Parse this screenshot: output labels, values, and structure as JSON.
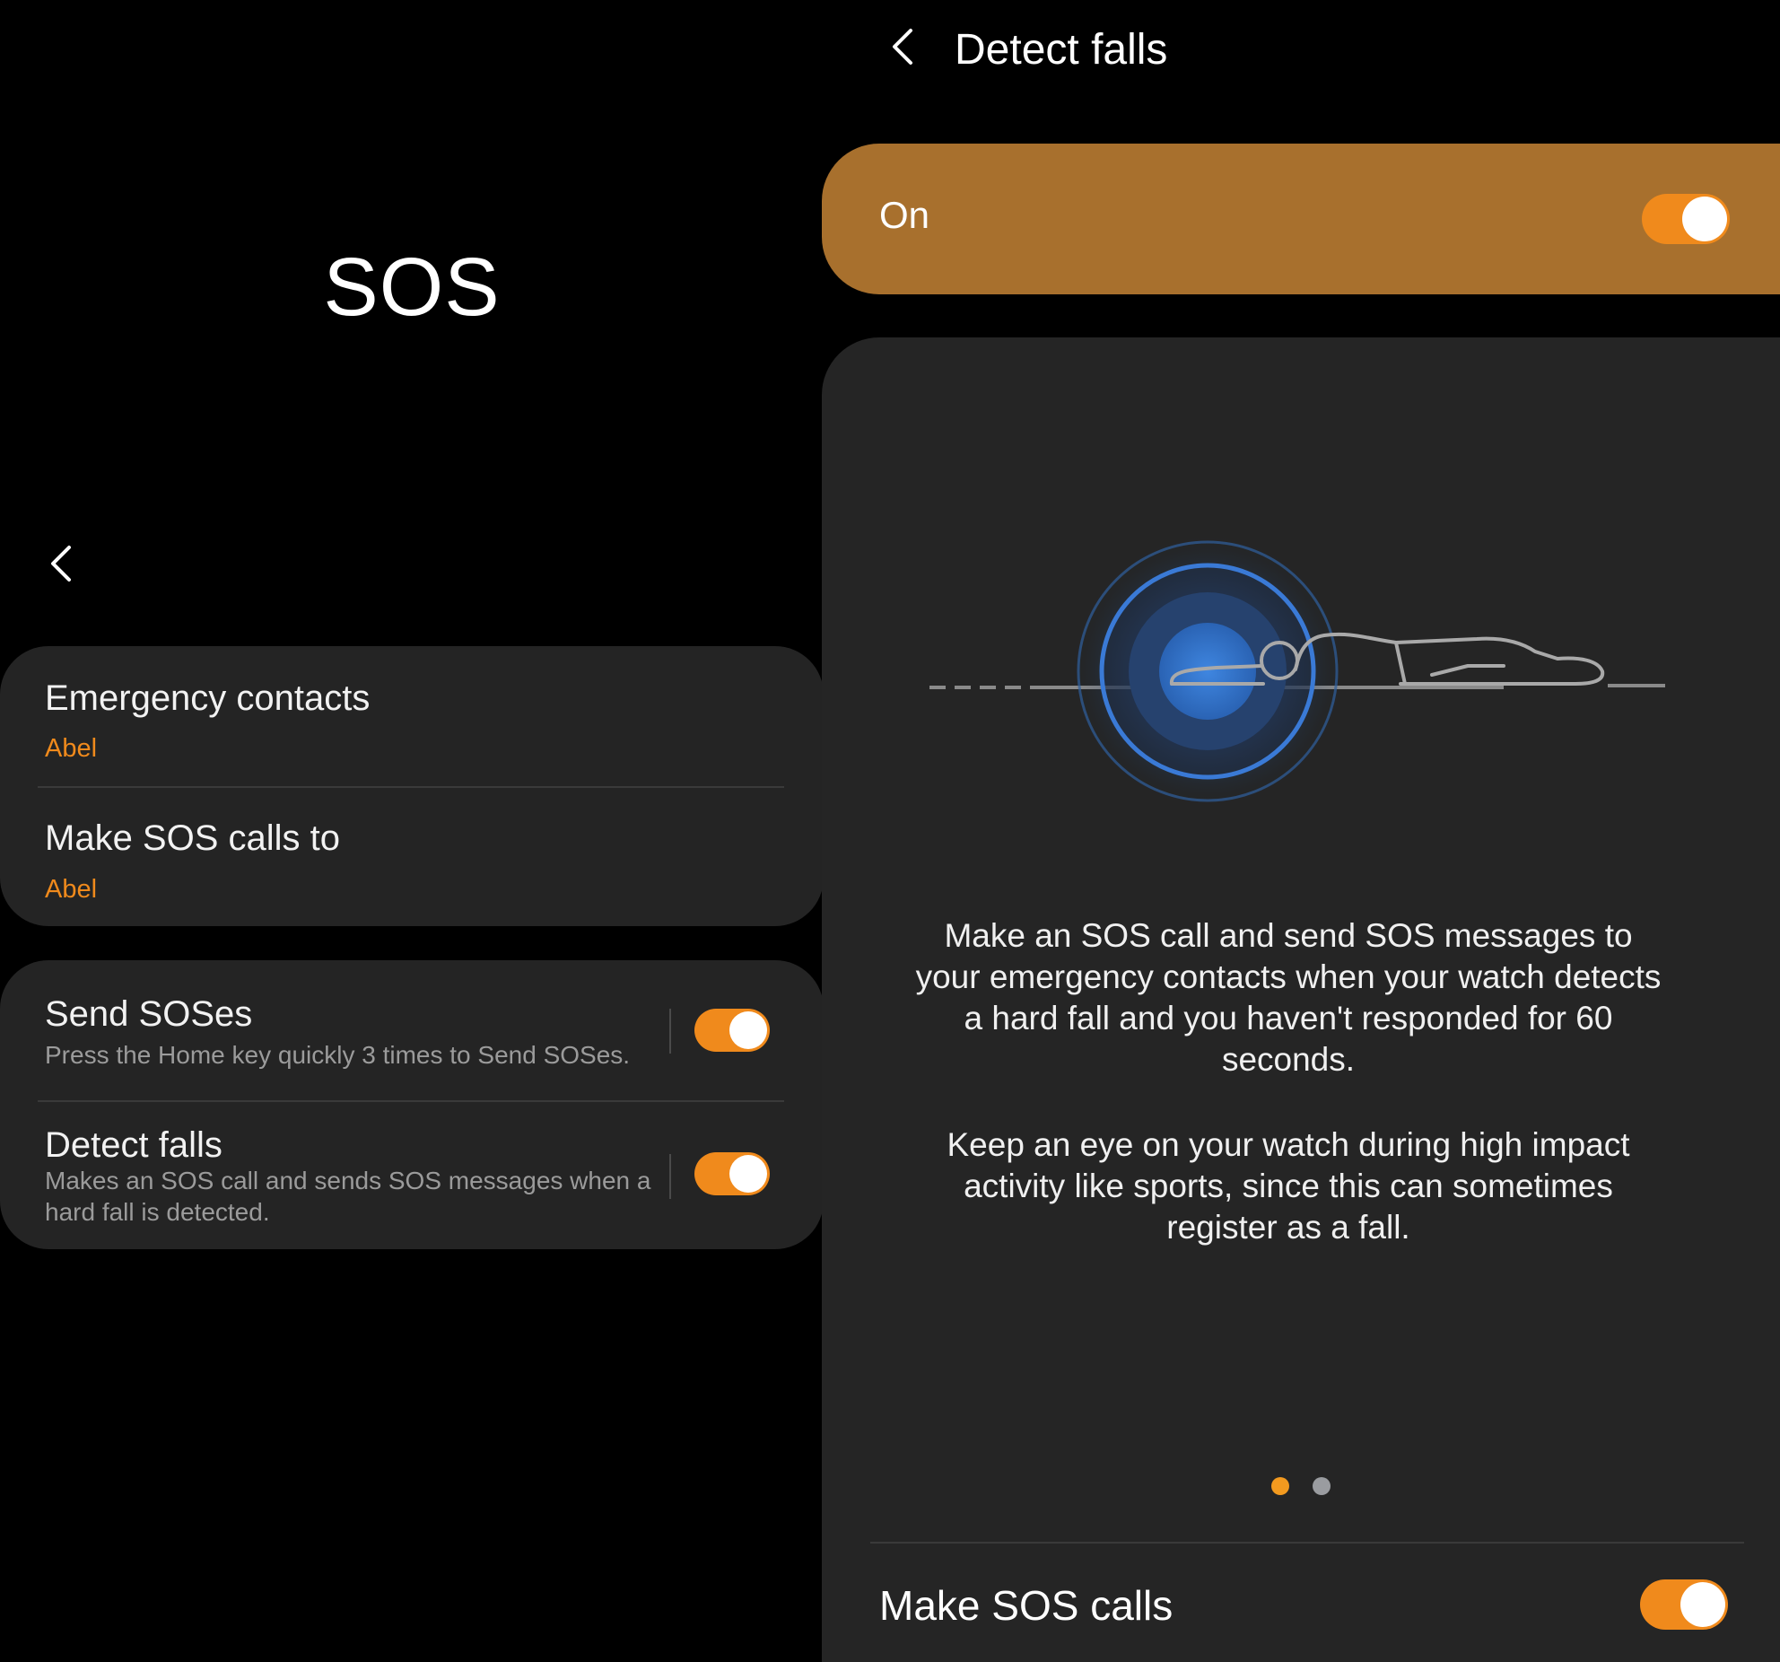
{
  "colors": {
    "accent": "#f08a1c",
    "on_bar": "#a8702d",
    "card": "#242424",
    "background": "#000000",
    "ripple_blue": "#3a7ad6"
  },
  "left": {
    "title": "SOS",
    "back_icon": "chevron-left-icon",
    "contacts_card": {
      "emergency_contacts": {
        "title": "Emergency contacts",
        "value": "Abel"
      },
      "make_sos_calls_to": {
        "title": "Make SOS calls to",
        "value": "Abel"
      }
    },
    "sos_card": {
      "send_soses": {
        "title": "Send SOSes",
        "description": "Press the Home key quickly 3 times to Send SOSes.",
        "enabled": true
      },
      "detect_falls": {
        "title": "Detect falls",
        "description": "Makes an SOS call and sends SOS messages when a hard fall is detected.",
        "enabled": true
      }
    }
  },
  "right": {
    "back_icon": "chevron-left-icon",
    "title": "Detect falls",
    "master_switch": {
      "label": "On",
      "enabled": true
    },
    "illustration_icon": "fall-detection-illustration",
    "info_paragraphs": [
      "Make an SOS call and send SOS messages to your emergency contacts when your watch detects a hard fall and you haven't responded for 60 seconds.",
      "Keep an eye on your watch during high impact activity like sports, since this can sometimes register as a fall."
    ],
    "pager": {
      "count": 2,
      "active_index": 0
    },
    "make_sos_calls": {
      "label": "Make SOS calls",
      "enabled": true
    }
  }
}
